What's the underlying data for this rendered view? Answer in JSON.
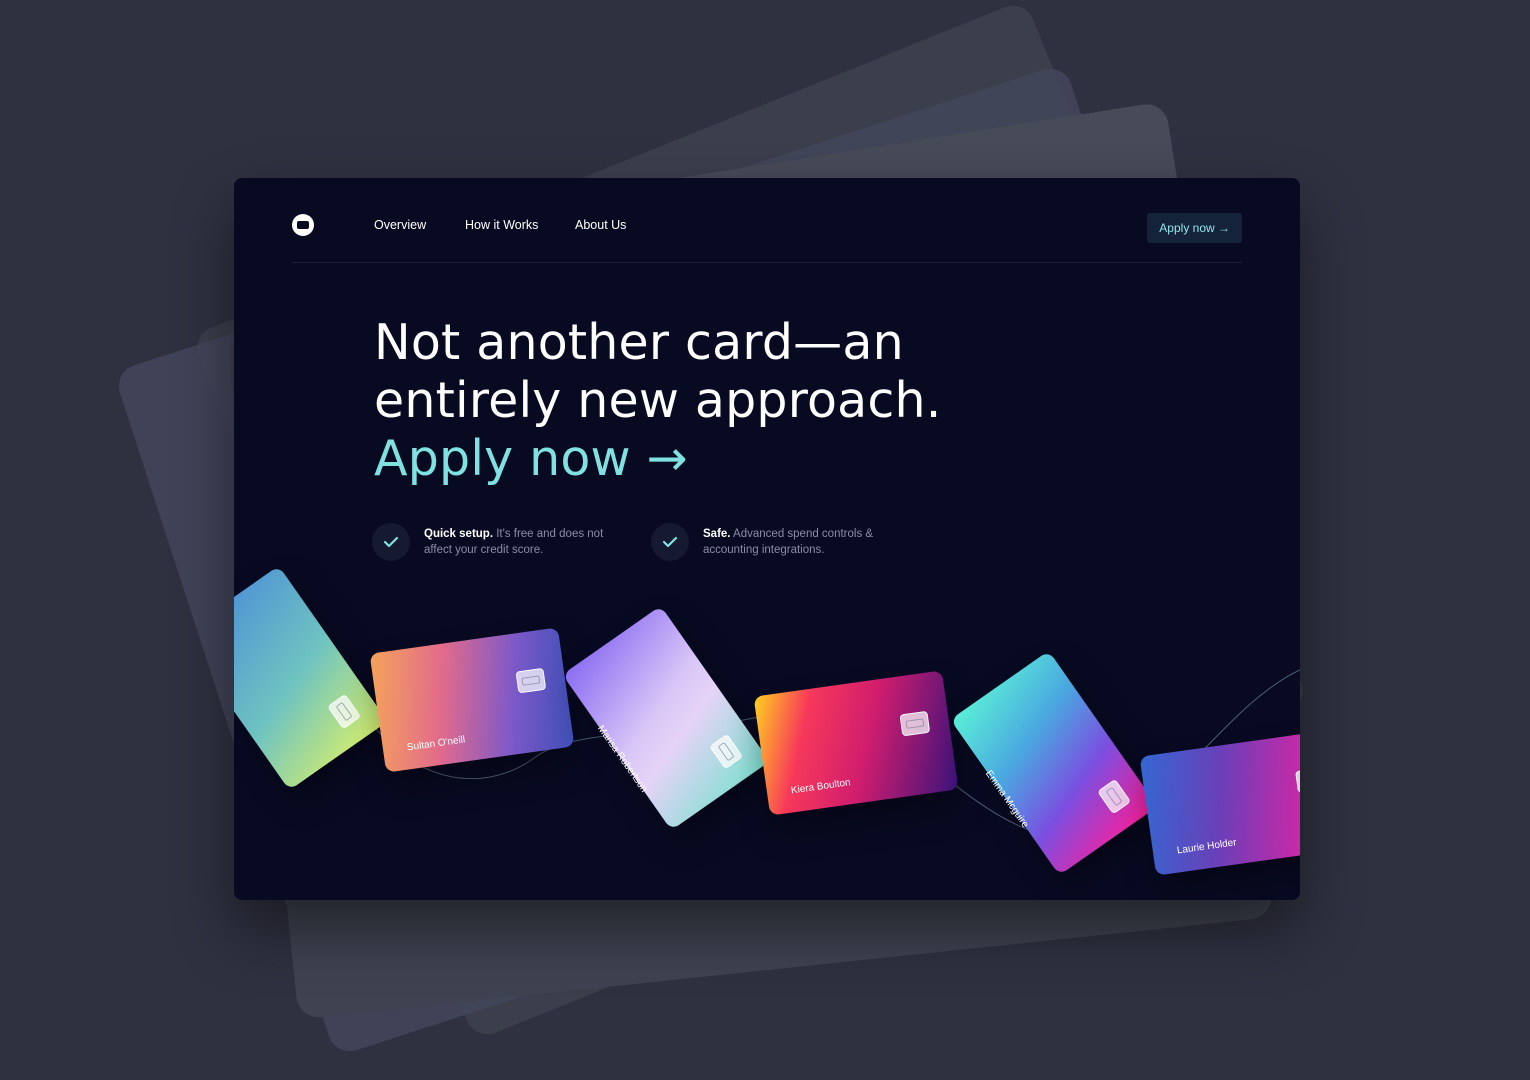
{
  "nav": {
    "logo_icon": "card-logo-icon",
    "links": [
      "Overview",
      "How it Works",
      "About Us"
    ],
    "apply_label": "Apply now →"
  },
  "hero": {
    "headline_line1": "Not another card—an",
    "headline_line2": "entirely new approach.",
    "cta": "Apply now →"
  },
  "features": [
    {
      "icon": "check-icon",
      "title": "Quick setup.",
      "text": " It's free and does not affect your credit score."
    },
    {
      "icon": "check-icon",
      "title": "Safe.",
      "text": " Advanced spend controls & accounting integrations."
    }
  ],
  "cards": [
    {
      "name": "",
      "gradient": [
        "#4a8ed8",
        "#6fc3c0",
        "#d6ef6c"
      ]
    },
    {
      "name": "Sultan O'neill",
      "gradient": [
        "#f5a35a",
        "#e26b8a",
        "#7c59c9",
        "#3d4fb5"
      ]
    },
    {
      "name": "Marisa Robertson",
      "gradient": [
        "#8a6cf2",
        "#d9c6f7",
        "#e6d3f7",
        "#7ee0d0"
      ]
    },
    {
      "name": "Kiera Boulton",
      "gradient": [
        "#ffd21f",
        "#f7385a",
        "#d01d6e",
        "#3a137a"
      ]
    },
    {
      "name": "Emma Mcguire",
      "gradient": [
        "#5af0d6",
        "#4aa7e0",
        "#7a4fe0",
        "#ff1e9a"
      ]
    },
    {
      "name": "Laurie Holder",
      "gradient": [
        "#3467d2",
        "#6b3fb8",
        "#c02ba8",
        "#ff2aa0"
      ]
    }
  ],
  "colors": {
    "background": "#2f3140",
    "window": "#080a22",
    "accent": "#7fe2e0"
  }
}
